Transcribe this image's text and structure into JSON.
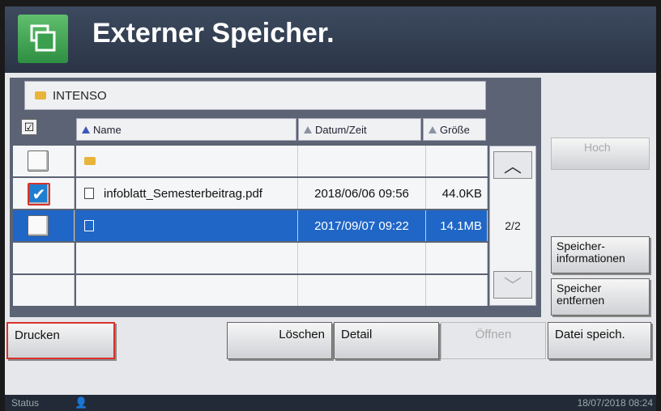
{
  "header": {
    "title": "Externer Speicher.",
    "icon": "file-copy-icon"
  },
  "path": {
    "label": "INTENSO",
    "icon": "folder-icon"
  },
  "columns": {
    "name": "Name",
    "datetime": "Datum/Zeit",
    "size": "Größe"
  },
  "rows": [
    {
      "type": "folder",
      "name": "",
      "datetime": "",
      "size": "",
      "checked": false,
      "selected": false
    },
    {
      "type": "file",
      "name": "infoblatt_Semesterbeitrag.pdf",
      "datetime": "2018/06/06 09:56",
      "size": "44.0KB",
      "checked": true,
      "selected": false
    },
    {
      "type": "file",
      "name": "",
      "datetime": "2017/09/07 09:22",
      "size": "14.1MB",
      "checked": false,
      "selected": true
    },
    {
      "type": "empty",
      "name": "",
      "datetime": "",
      "size": "",
      "checked": false,
      "selected": false
    },
    {
      "type": "empty",
      "name": "",
      "datetime": "",
      "size": "",
      "checked": false,
      "selected": false
    }
  ],
  "pagination": {
    "page": "2/2"
  },
  "right_buttons": {
    "up": "Hoch",
    "storage_info": "Speicher-\ninformationen",
    "remove": "Speicher\nentfernen",
    "save_file": "Datei speich."
  },
  "bottom_buttons": {
    "print": "Drucken",
    "delete": "Löschen",
    "detail": "Detail",
    "open": "Öffnen"
  },
  "status": {
    "label": "Status",
    "datetime": "18/07/2018 08:24"
  },
  "colors": {
    "selected_row": "#1f66c6",
    "highlight_border": "#d8322c",
    "header_bg": "#2a3446"
  }
}
